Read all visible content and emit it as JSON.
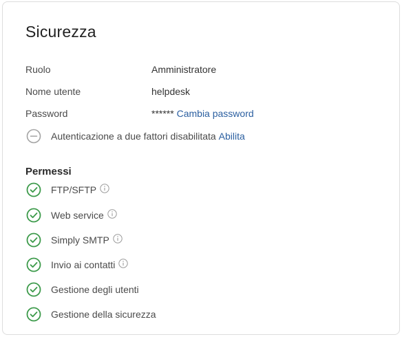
{
  "security": {
    "title": "Sicurezza",
    "rows": [
      {
        "label": "Ruolo",
        "value": "Amministratore"
      },
      {
        "label": "Nome utente",
        "value": "helpdesk"
      },
      {
        "label": "Password",
        "value": "******",
        "link": "Cambia password"
      }
    ],
    "mfa": {
      "text": "Autenticazione a due fattori disabilitata",
      "link": "Abilita",
      "icon": "minus-circle-icon"
    },
    "permissions_title": "Permessi",
    "permissions": [
      {
        "label": "FTP/SFTP",
        "info": true
      },
      {
        "label": "Web service",
        "info": true
      },
      {
        "label": "Simply SMTP",
        "info": true
      },
      {
        "label": "Invio ai contatti",
        "info": true
      },
      {
        "label": "Gestione degli utenti",
        "info": false
      },
      {
        "label": "Gestione della sicurezza",
        "info": false
      }
    ],
    "colors": {
      "check": "#3c9a4a",
      "link": "#2b5fa0",
      "disabled_icon": "#9a9a9a"
    }
  }
}
